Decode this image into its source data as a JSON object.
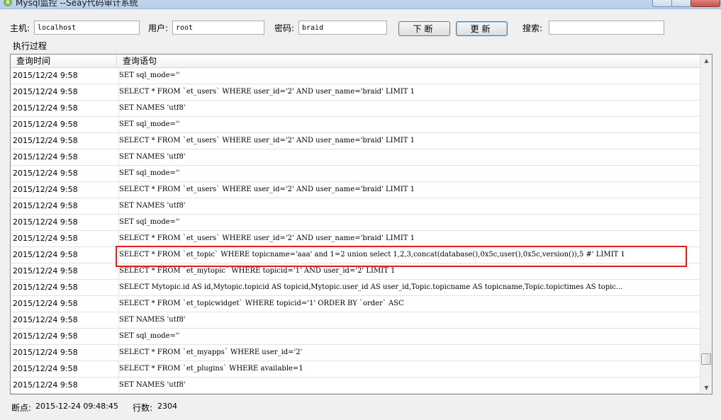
{
  "window": {
    "title": "Mysql监控 --Seay代码审计系统"
  },
  "toolbar": {
    "host_label": "主机:",
    "host_value": "localhost",
    "user_label": "用户:",
    "user_value": "root",
    "password_label": "密码:",
    "password_value": "braid",
    "break_label": "下断",
    "refresh_label": "更新",
    "search_label": "搜索:",
    "search_value": ""
  },
  "log": {
    "group_label": "执行过程",
    "columns": [
      "查询时间",
      "查询语句"
    ],
    "rows": [
      {
        "time": "2015/12/24 9:58",
        "sql": "SET sql_mode=''"
      },
      {
        "time": "2015/12/24 9:58",
        "sql": "SELECT * FROM `et_users` WHERE user_id='2' AND user_name='braid' LIMIT 1"
      },
      {
        "time": "2015/12/24 9:58",
        "sql": "SET NAMES 'utf8'"
      },
      {
        "time": "2015/12/24 9:58",
        "sql": "SET sql_mode=''"
      },
      {
        "time": "2015/12/24 9:58",
        "sql": "SELECT * FROM `et_users` WHERE user_id='2' AND user_name='braid' LIMIT 1"
      },
      {
        "time": "2015/12/24 9:58",
        "sql": "SET NAMES 'utf8'"
      },
      {
        "time": "2015/12/24 9:58",
        "sql": "SET sql_mode=''"
      },
      {
        "time": "2015/12/24 9:58",
        "sql": "SELECT * FROM `et_users` WHERE user_id='2' AND user_name='braid' LIMIT 1"
      },
      {
        "time": "2015/12/24 9:58",
        "sql": "SET NAMES 'utf8'"
      },
      {
        "time": "2015/12/24 9:58",
        "sql": "SET sql_mode=''"
      },
      {
        "time": "2015/12/24 9:58",
        "sql": "SELECT * FROM `et_users` WHERE user_id='2' AND user_name='braid' LIMIT 1"
      },
      {
        "time": "2015/12/24 9:58",
        "sql": "SELECT * FROM `et_topic` WHERE topicname='aaa' and 1=2 union select 1,2,3,concat(database(),0x5c,user(),0x5c,version()),5 #' LIMIT 1"
      },
      {
        "time": "2015/12/24 9:58",
        "sql": "SELECT * FROM `et_mytopic` WHERE topicid='1' AND user_id='2' LIMIT 1"
      },
      {
        "time": "2015/12/24 9:58",
        "sql": "SELECT Mytopic.id AS id,Mytopic.topicid AS topicid,Mytopic.user_id AS user_id,Topic.topicname AS topicname,Topic.topictimes AS topic..."
      },
      {
        "time": "2015/12/24 9:58",
        "sql": "SELECT * FROM `et_topicwidget` WHERE topicid='1' ORDER BY `order` ASC"
      },
      {
        "time": "2015/12/24 9:58",
        "sql": "SET NAMES 'utf8'"
      },
      {
        "time": "2015/12/24 9:58",
        "sql": "SET sql_mode=''"
      },
      {
        "time": "2015/12/24 9:58",
        "sql": "SELECT * FROM `et_myapps` WHERE user_id='2'"
      },
      {
        "time": "2015/12/24 9:58",
        "sql": "SELECT * FROM `et_plugins` WHERE available=1"
      },
      {
        "time": "2015/12/24 9:58",
        "sql": "SET NAMES 'utf8'"
      }
    ]
  },
  "status": {
    "breakpoint_label": "断点:",
    "breakpoint_value": "2015-12-24 09:48:45",
    "rowcount_label": "行数:",
    "rowcount_value": "2304"
  },
  "colors": {
    "highlight": "#e02020",
    "window_bg": "#f0f0f0"
  }
}
